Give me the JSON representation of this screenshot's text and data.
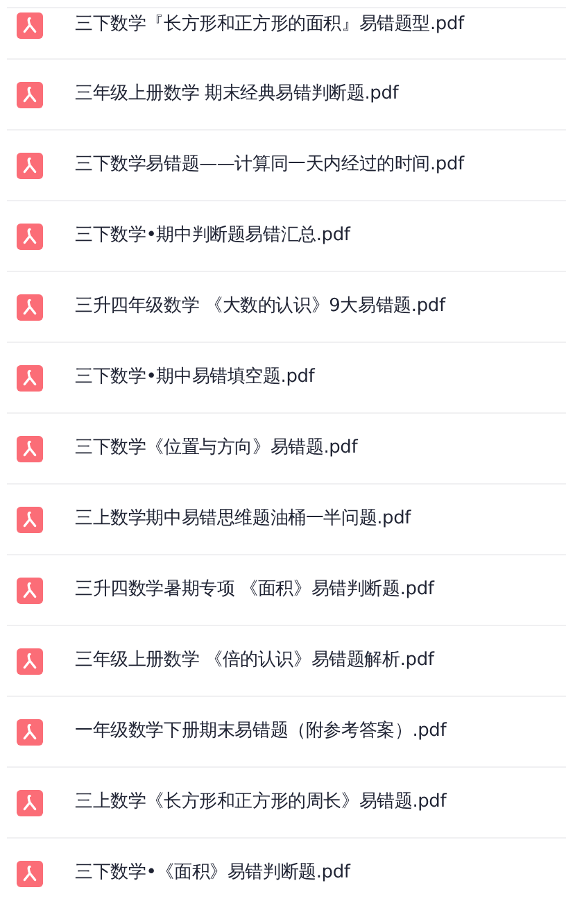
{
  "files": [
    {
      "name": "三下数学『长方形和正方形的面积』易错题型.pdf"
    },
    {
      "name": "三年级上册数学 期末经典易错判断题.pdf"
    },
    {
      "name": "三下数学易错题——计算同一天内经过的时间.pdf"
    },
    {
      "name": "三下数学•期中判断题易错汇总.pdf"
    },
    {
      "name": "三升四年级数学 《大数的认识》9大易错题.pdf"
    },
    {
      "name": "三下数学•期中易错填空题.pdf"
    },
    {
      "name": "三下数学《位置与方向》易错题.pdf"
    },
    {
      "name": "三上数学期中易错思维题油桶一半问题.pdf"
    },
    {
      "name": "三升四数学暑期专项 《面积》易错判断题.pdf"
    },
    {
      "name": "三年级上册数学 《倍的认识》易错题解析.pdf"
    },
    {
      "name": "一年级数学下册期末易错题（附参考答案）.pdf"
    },
    {
      "name": "三上数学《长方形和正方形的周长》易错题.pdf"
    },
    {
      "name": "三下数学•《面积》易错判断题.pdf"
    }
  ]
}
